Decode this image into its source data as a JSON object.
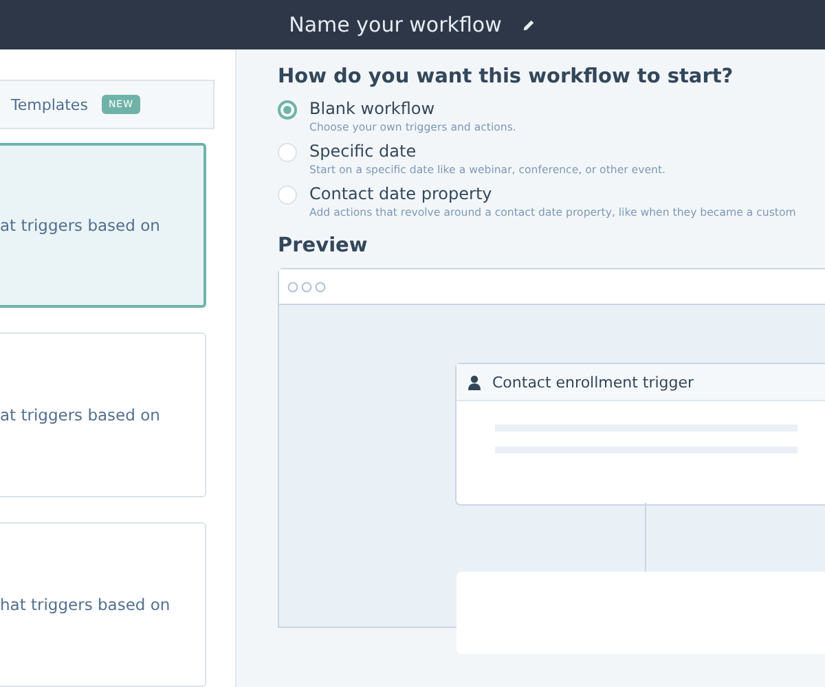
{
  "header": {
    "title": "Name your workflow"
  },
  "sidebar": {
    "tabs": [
      {
        "label": "Templates",
        "badge": "NEW",
        "selected": false
      }
    ],
    "cards": [
      {
        "text": "at triggers based on",
        "selected": true
      },
      {
        "text": "at triggers based on",
        "selected": false
      },
      {
        "text": "hat triggers based on",
        "selected": false
      }
    ]
  },
  "start": {
    "heading": "How do you want this workflow to start?",
    "options": [
      {
        "label": "Blank workflow",
        "description": "Choose your own triggers and actions.",
        "selected": true
      },
      {
        "label": "Specific date",
        "description": "Start on a specific date like a webinar, conference, or other event.",
        "selected": false
      },
      {
        "label": "Contact date property",
        "description": "Add actions that revolve around a contact date property, like when they became a custom",
        "selected": false
      }
    ]
  },
  "preview": {
    "heading": "Preview",
    "trigger_card": {
      "title": "Contact enrollment trigger"
    }
  }
}
